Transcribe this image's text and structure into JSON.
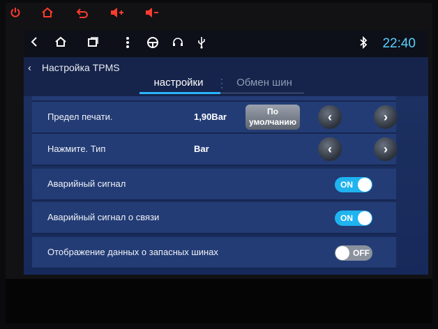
{
  "hardware_buttons": [
    {
      "name": "power-icon"
    },
    {
      "name": "home-icon"
    },
    {
      "name": "back-icon"
    },
    {
      "name": "volume-up-icon"
    },
    {
      "name": "volume-down-icon"
    }
  ],
  "statusbar": {
    "icons": [
      "back-icon",
      "home-icon",
      "recent-apps-icon",
      "menu-dots-icon",
      "steering-wheel-icon",
      "headphones-icon",
      "usb-icon",
      "bluetooth-icon"
    ],
    "time": "22:40"
  },
  "titlebar": {
    "title": "Настройка TPMS",
    "tabs": [
      {
        "label": "настройки",
        "active": true
      },
      {
        "label": "Обмен шин",
        "active": false
      }
    ]
  },
  "settings": {
    "pressure_limit": {
      "label": "Предел печати.",
      "value": "1,90Bar",
      "default_button": "По умолчанию"
    },
    "pressure_unit": {
      "label": "Нажмите. Тип",
      "value": "Bar"
    },
    "alarm": {
      "label": "Аварийный сигнал",
      "state": "ON"
    },
    "connection_alarm": {
      "label": "Аварийный сигнал о связи",
      "state": "ON"
    },
    "spare_tire_display": {
      "label": "Отображение данных о запасных шинах",
      "state": "OFF"
    }
  },
  "colors": {
    "accent": "#29b4ff",
    "hardware_buttons": "#ff3b2f",
    "row_background": "#233c75",
    "toggle_on": "#1fb3f0"
  }
}
